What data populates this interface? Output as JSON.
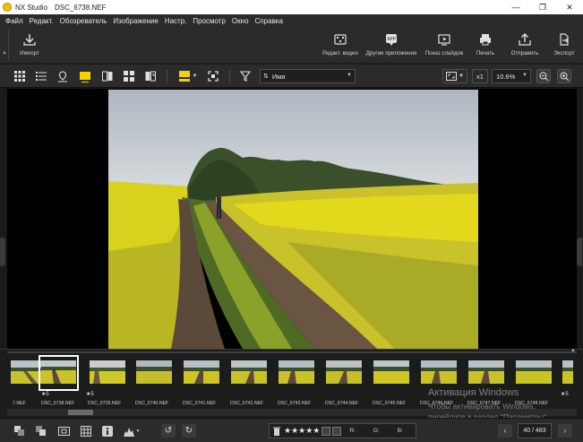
{
  "window": {
    "app_name": "NX Studio",
    "file_name": "DSC_6738.NEF",
    "minimize": "—",
    "maximize": "❐",
    "close": "✕"
  },
  "menu": [
    "Файл",
    "Редакт.",
    "Обозреватель",
    "Изображение",
    "Настр.",
    "Просмотр",
    "Окно",
    "Справка"
  ],
  "toolbar": {
    "import_label": "Импорт",
    "edit_video_label": "Редакт. видео",
    "other_apps_label": "Другие приложения",
    "slideshow_label": "Показ слайдов",
    "print_label": "Печать",
    "send_label": "Отправить",
    "export_label": "Экспорт"
  },
  "viewbar": {
    "sort_value": "Имя",
    "one_to_one": "x1",
    "zoom_value": "10.6%"
  },
  "filmstrip": {
    "thumbs": [
      {
        "name": "7.NEF",
        "rating": ""
      },
      {
        "name": "DSC_6738.NEF",
        "rating": "★5"
      },
      {
        "name": "DSC_6739.NEF",
        "rating": "★5"
      },
      {
        "name": "DSC_6740.NEF",
        "rating": ""
      },
      {
        "name": "DSC_6741.NEF",
        "rating": ""
      },
      {
        "name": "DSC_6742.NEF",
        "rating": ""
      },
      {
        "name": "DSC_6743.NEF",
        "rating": ""
      },
      {
        "name": "DSC_6744.NEF",
        "rating": ""
      },
      {
        "name": "DSC_6745.NEF",
        "rating": ""
      },
      {
        "name": "DSC_6746.NEF",
        "rating": ""
      },
      {
        "name": "DSC_6747.NEF",
        "rating": ""
      },
      {
        "name": "DSC_6748.NEF",
        "rating": ""
      },
      {
        "name": "",
        "rating": "★5"
      }
    ],
    "selected_index": 1
  },
  "watermark": {
    "line1": "Активация Windows",
    "line2": "Чтобы активировать Windows,",
    "line3": "перейдите в раздел \"Параметры\"."
  },
  "bottombar": {
    "stars": "★★★★★",
    "r_label": "R:",
    "g_label": "G:",
    "b_label": "B:",
    "counter": "40 / 483"
  },
  "colors": {
    "accent_yellow": "#f2d200",
    "chrome_bg": "#2b2b2b"
  }
}
